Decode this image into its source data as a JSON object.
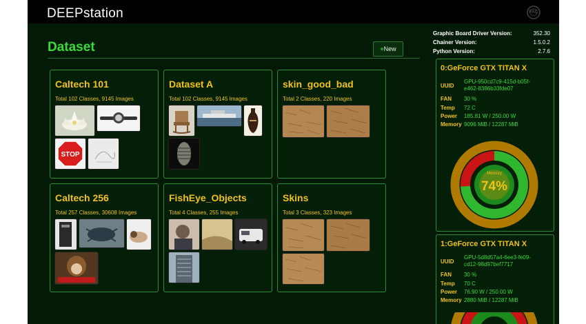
{
  "app": {
    "brand": "DEEPstation",
    "logo_icon": "fac-logo-icon",
    "logo_text": "FAC"
  },
  "main": {
    "title": "Dataset",
    "new_label": "New"
  },
  "datasets": [
    {
      "name": "Caltech 101",
      "summary": "Total 102 Classes, 9145 Images"
    },
    {
      "name": "Dataset A",
      "summary": "Total 102 Classes, 9145 Images"
    },
    {
      "name": "skin_good_bad",
      "summary": "Total 2 Classes, 220 Images"
    },
    {
      "name": "Caltech 256",
      "summary": "Total 257 Classes, 30608 Images"
    },
    {
      "name": "FishEye_Objects",
      "summary": "Total 4 Classes, 255 Images"
    },
    {
      "name": "Skins",
      "summary": "Total 3 Classes, 323 Images"
    }
  ],
  "versions": [
    {
      "label": "Graphic Board Driver Version:",
      "value": "352.30"
    },
    {
      "label": "Chainer Version:",
      "value": "1.5.0.2"
    },
    {
      "label": "Python Version:",
      "value": "2.7.6"
    }
  ],
  "gpus": [
    {
      "title": "0:GeForce GTX TITAN X",
      "uuid_label": "UUID",
      "uuid": "GPU-950cd7c9-415d-b05f-e462-8386b33fde07",
      "fan_label": "FAN",
      "fan": "30 %",
      "temp_label": "Temp",
      "temp": "72 C",
      "power_label": "Power",
      "power": "185.81 W / 250.00 W",
      "memory_label": "Memory",
      "memory": "9096 MiB / 12287 MiB",
      "gauge_label": "Memory",
      "gauge_value": "74%",
      "memory_fraction": 0.74
    },
    {
      "title": "1:GeForce GTX TITAN X",
      "uuid_label": "UUID",
      "uuid": "GPU-5d8d57a4-6ee3-fe09-cd12-98d97bef7717",
      "fan_label": "FAN",
      "fan": "30 %",
      "temp_label": "Temp",
      "temp": "70 C",
      "power_label": "Power",
      "power": "76.90 W / 250.00 W",
      "memory_label": "Memory",
      "memory": "2880 MiB / 12287 MiB"
    }
  ],
  "colors": {
    "accent_green": "#3cd93c",
    "label_yellow": "#f2c21b",
    "panel_bg": "#041f08",
    "border": "#2e8c37",
    "gauge_red": "#d01010",
    "gauge_orange": "#c88a00"
  }
}
